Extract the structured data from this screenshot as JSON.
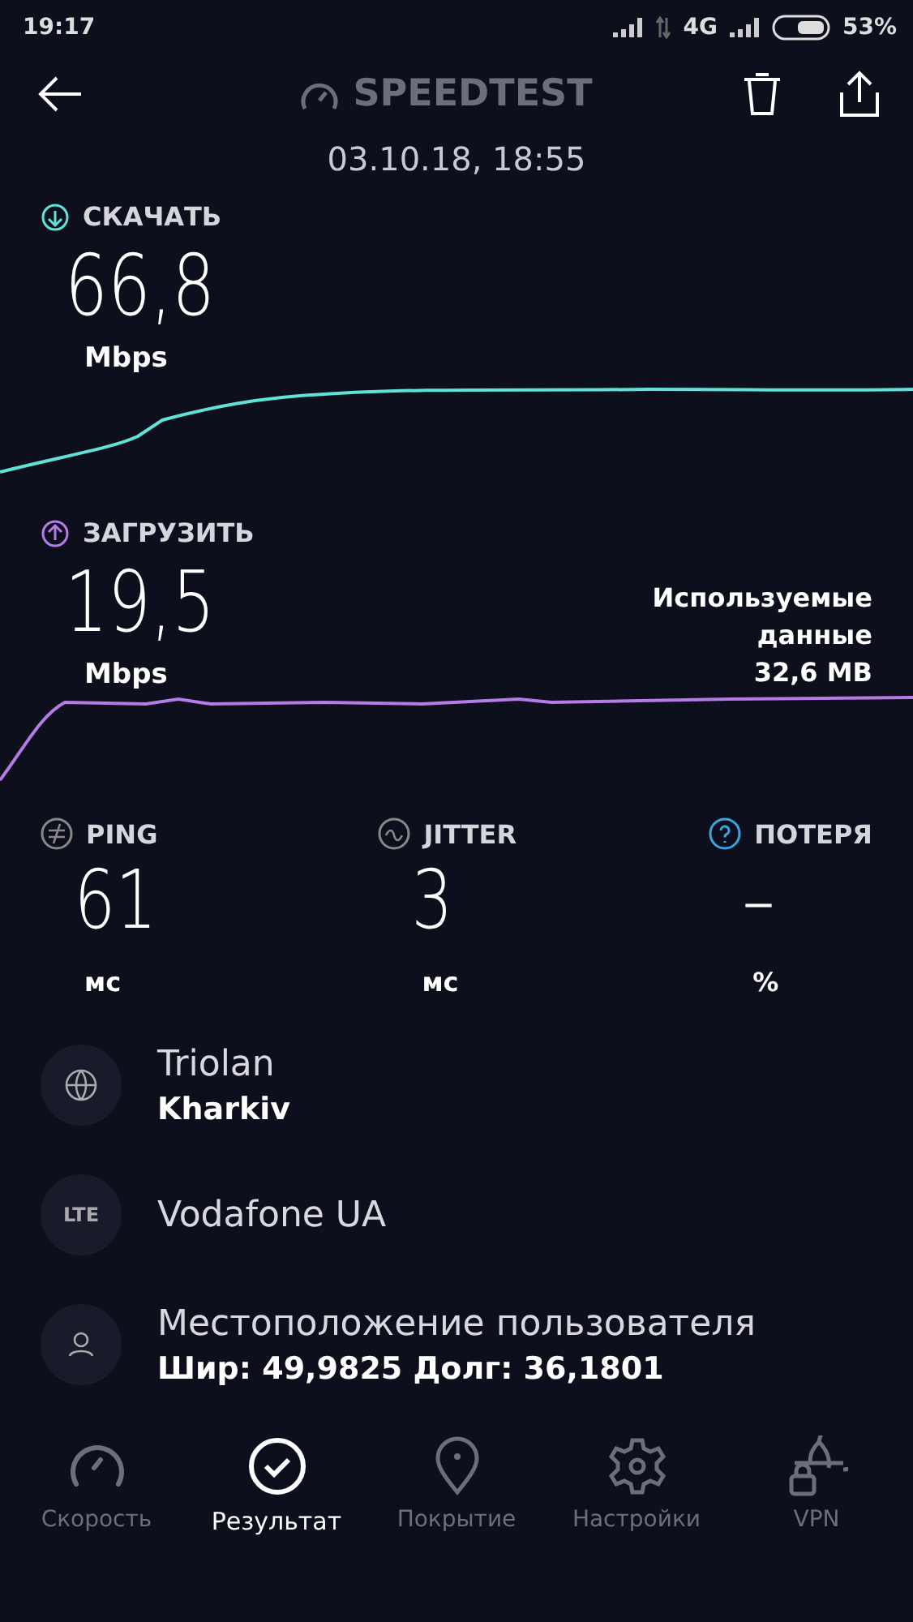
{
  "status_bar": {
    "time": "19:17",
    "network": "4G",
    "battery": "53%"
  },
  "header": {
    "title": "SPEEDTEST",
    "date": "03.10.18, 18:55"
  },
  "metrics": [
    {
      "kind": "download",
      "label": "СКАЧАТЬ",
      "value": "66,8",
      "unit": "Mbps",
      "color": "#5fe3d8"
    },
    {
      "kind": "upload",
      "label": "ЗАГРУЗИТЬ",
      "value": "19,5",
      "unit": "Mbps",
      "color": "#b57be6"
    }
  ],
  "used_data": {
    "label": "Используемые данные",
    "value": "32,6 MB"
  },
  "stats": [
    {
      "kind": "ping",
      "label": "PING",
      "value": "61",
      "unit": "мс"
    },
    {
      "kind": "jitter",
      "label": "JITTER",
      "value": "3",
      "unit": "мс"
    },
    {
      "kind": "loss",
      "label": "ПОТЕРЯ",
      "value": "–",
      "unit": "%"
    }
  ],
  "info": [
    {
      "kind": "globe",
      "title": "Triolan",
      "subtitle": "Kharkiv"
    },
    {
      "kind": "lte",
      "badge": "LTE",
      "title": "Vodafone UA"
    },
    {
      "kind": "user",
      "title": "Местоположение пользователя",
      "subtitle": "Шир: 49,9825 Долг: 36,1801"
    }
  ],
  "nav": [
    {
      "kind": "speed",
      "label": "Скорость",
      "selected": false
    },
    {
      "kind": "result",
      "label": "Результат",
      "selected": true
    },
    {
      "kind": "coverage",
      "label": "Покрытие",
      "selected": false
    },
    {
      "kind": "settings",
      "label": "Настройки",
      "selected": false
    },
    {
      "kind": "vpn",
      "label": "VPN",
      "selected": false
    }
  ]
}
